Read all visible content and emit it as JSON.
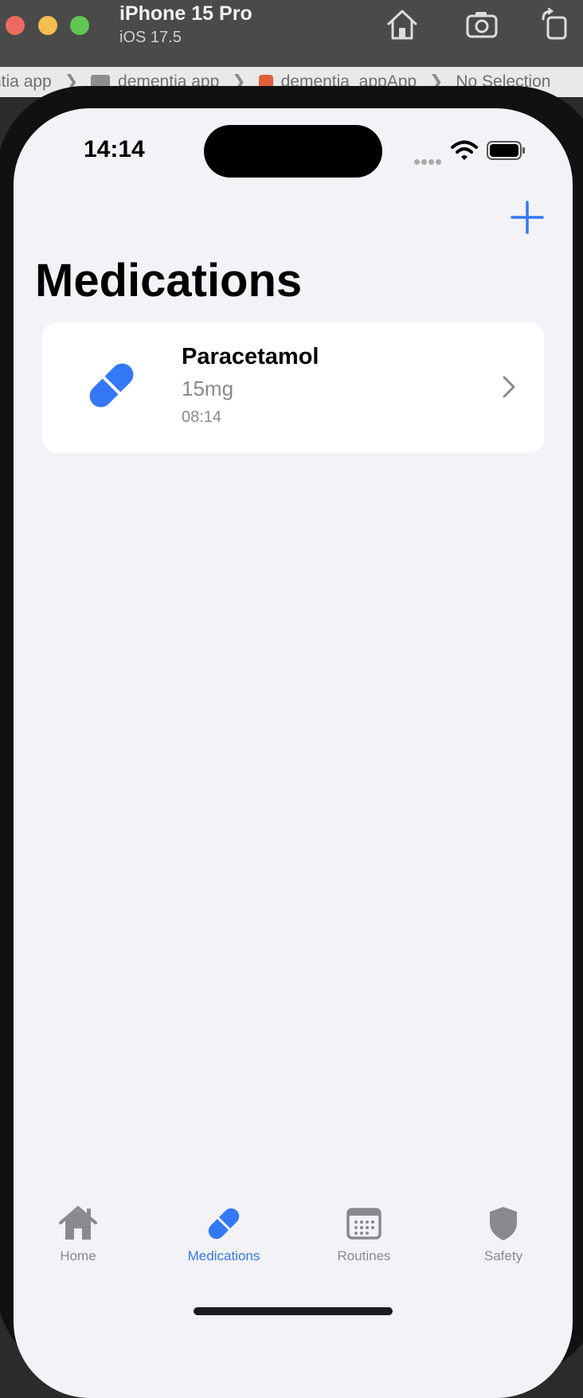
{
  "simulator": {
    "device_name": "iPhone 15 Pro",
    "os_version": "iOS 17.5",
    "toolbar_buttons": [
      "home-icon",
      "screenshot-icon",
      "rotate-icon"
    ]
  },
  "breadcrumb": {
    "items": [
      "ntia app",
      "dementia app",
      "dementia_appApp",
      "No Selection"
    ],
    "separator": "❯"
  },
  "status_bar": {
    "time": "14:14"
  },
  "nav": {
    "add_icon": "plus-icon",
    "title": "Medications"
  },
  "medications": [
    {
      "name": "Paracetamol",
      "dose": "15mg",
      "time": "08:14",
      "icon": "pill-icon"
    }
  ],
  "tabs": [
    {
      "label": "Home",
      "icon": "house-icon",
      "active": false
    },
    {
      "label": "Medications",
      "icon": "pill-icon",
      "active": true
    },
    {
      "label": "Routines",
      "icon": "calendar-icon",
      "active": false
    },
    {
      "label": "Safety",
      "icon": "shield-icon",
      "active": false
    }
  ],
  "colors": {
    "accent": "#3478f6",
    "background": "#f2f2f7",
    "card": "#ffffff",
    "secondary_text": "#8a8a8e"
  }
}
